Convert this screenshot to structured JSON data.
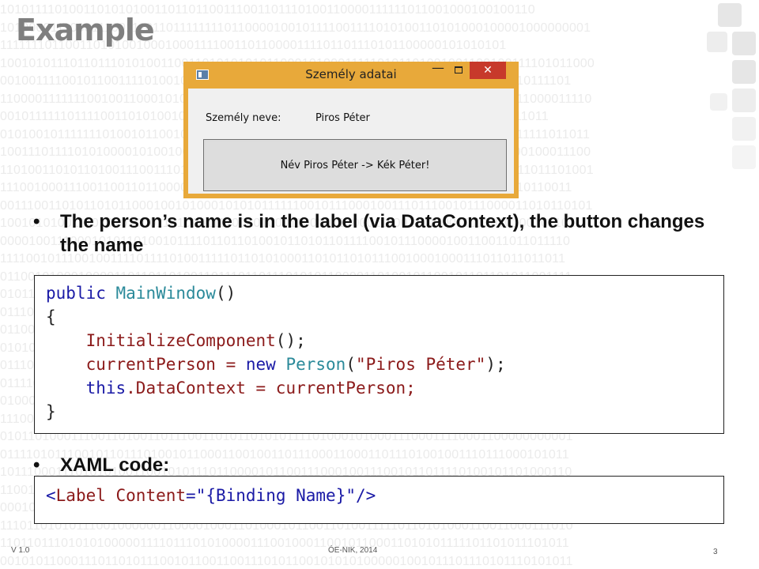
{
  "slide": {
    "title": "Example",
    "bullets": [
      "The person’s name is in the label (via DataContext), the button changes the name",
      "XAML code:"
    ],
    "bullet_char": "•"
  },
  "window": {
    "title": "Személy adatai",
    "min_glyph": "—",
    "close_glyph": "✕",
    "label_key": "Személy neve:",
    "label_value": "Piros Péter",
    "button_label": "Név Piros Péter -> Kék Péter!",
    "frame_color": "#e8a93a",
    "close_color": "#c7392b"
  },
  "code_block_1": {
    "l1_kw": "public",
    "l1_type": "MainWindow",
    "l1_rest": "()",
    "l2": "{",
    "l3_method": "InitializeComponent",
    "l3_rest": "();",
    "l4_a": "currentPerson = ",
    "l4_kw": "new",
    "l4_type": "Person",
    "l4_open": "(",
    "l4_str": "\"Piros Péter\"",
    "l4_close": ");",
    "l5_kw": "this",
    "l5_prop": ".DataContext = currentPerson;",
    "l6": "}"
  },
  "code_block_2": {
    "tag_open": "<",
    "tag_name": "Label",
    "attr": " Content",
    "eq": "=",
    "val": "\"{Binding Name}\"",
    "tag_close": "/>"
  },
  "footer": {
    "version": "V 1.0",
    "org": "ÓE-NIK, 2014",
    "page": "3"
  },
  "background_binary": [
    "10101111010011010101001101101100111001101110100110000111111011001000100100110",
    "1010000111000111001110110111111110110000100101111001111010100110101000100001000000001",
    "1111111011001101010010001000111100110110000111101101110101100000101010101",
    "1001010111011011101010011001101010101011000101000111110101101001001100100111101011000",
    "0010011110010110011110100101001101101010010011100010101001110110101011001110111101",
    "1100001111111001001100010101010111010001001111001101001001101001000110011011000011110",
    "0010111111011110011010100100110101001101001000101111101001011010110011011011011",
    "0101001011111110100101100101110001010111000101000101101110101101001010101111111011011",
    "1001110111101010000101001000110111100010001010100011110011110110111101100100100011100",
    "1101001101011010011100111011010100110010110001110010110001001101011000011011011101001",
    "1110010001110011001101100001000011100101001001011100111100101011010011011010110011",
    "0011100110101101011000100101000101010111111001011100010011101110010111000011010110101",
    "1001010100111010101000110101011110010100011001011000011100110110010111010100101101",
    "0000100111000101011010010111101101101001011010110111100101110000100110011011011110",
    "1111001011100100111101111010011111011010100011010110101110010001000111011011011011",
    "0110010100010000110110110100110111011011101010110000110100101100101101101011001111",
    "0101100111011100100111101011101110110011011101011101011010010110001110011010001011",
    "0111011001110100111010101001111011001101110001111111110000111011110000111011000111",
    "0110010011111111001000111100111100101001011101100100101100100101011001001100110010",
    "0101000111011001110011011100110101010011010011001011011101101001101011101110010100",
    "0111001101001100011101101100101111000100011010001101110110000110101100100011010001",
    "0111100001001101010001011100110011100010010000100011100010101100011000101101000111",
    "0100001011100110011010100001110110001100110101100001101101000110011100110011010101",
    "1110000100011000010001010010100000001000000101111100101101110001100101111100101101",
    "0101101000111001101001101110011010110101011110100010100011100011110001100000000001",
    "0111101011100101101110100101100011001001101110001100011011101001001110111000101011",
    "1011100011101010100110010101110110000101100111000100111001011011110100101101000110",
    "1100110111001101110010101010110001100101101110000110011011100100001011011110101110",
    "0001011101111101111101111101011101100011101001101111000101001010110011100110010111",
    "1110110101011100100000011000010001101000101100110100111110110101000110011000111010",
    "1101101110101010000011110111010100001110010001100101100011010101111101101011101011",
    "0010101100011101101011100101100110011101011001010101000001001011101110101110101011"
  ]
}
